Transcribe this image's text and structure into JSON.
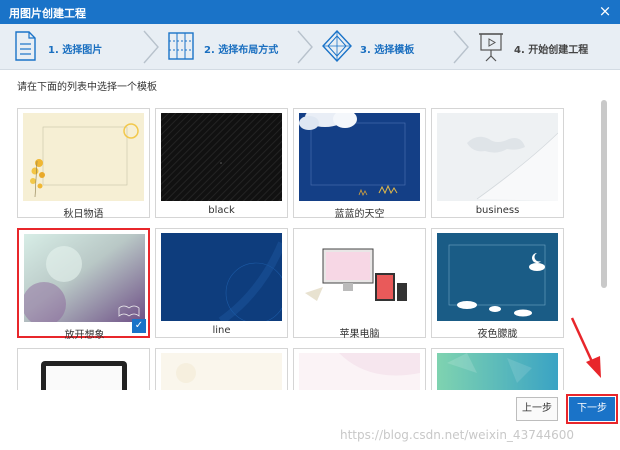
{
  "window": {
    "title": "用图片创建工程",
    "close_label": "×"
  },
  "steps": [
    {
      "number_label": "1. 选择图片",
      "icon": "image-page-icon",
      "active": true
    },
    {
      "number_label": "2. 选择布局方式",
      "icon": "layout-grid-icon",
      "active": true
    },
    {
      "number_label": "3. 选择模板",
      "icon": "template-diamond-icon",
      "active": true
    },
    {
      "number_label": "4. 开始创建工程",
      "icon": "presentation-board-icon",
      "active": false
    }
  ],
  "prompt": "请在下面的列表中选择一个模板",
  "templates": [
    {
      "name": "秋日物语",
      "selected": false
    },
    {
      "name": "black",
      "selected": false
    },
    {
      "name": "蓝蓝的天空",
      "selected": false
    },
    {
      "name": "business",
      "selected": false
    },
    {
      "name": "放开想象",
      "selected": true
    },
    {
      "name": "line",
      "selected": false
    },
    {
      "name": "苹果电脑",
      "selected": false
    },
    {
      "name": "夜色朦胧",
      "selected": false
    },
    {
      "name": "",
      "selected": false
    },
    {
      "name": "",
      "selected": false
    },
    {
      "name": "",
      "selected": false
    },
    {
      "name": "",
      "selected": false
    }
  ],
  "checkmark": "✓",
  "buttons": {
    "prev": "上一步",
    "next": "下一步"
  },
  "watermark": "https://blog.csdn.net/weixin_43744600",
  "colors": {
    "accent": "#1a73c8",
    "highlight": "#e8262b",
    "step_bar": "#e8eef4"
  }
}
